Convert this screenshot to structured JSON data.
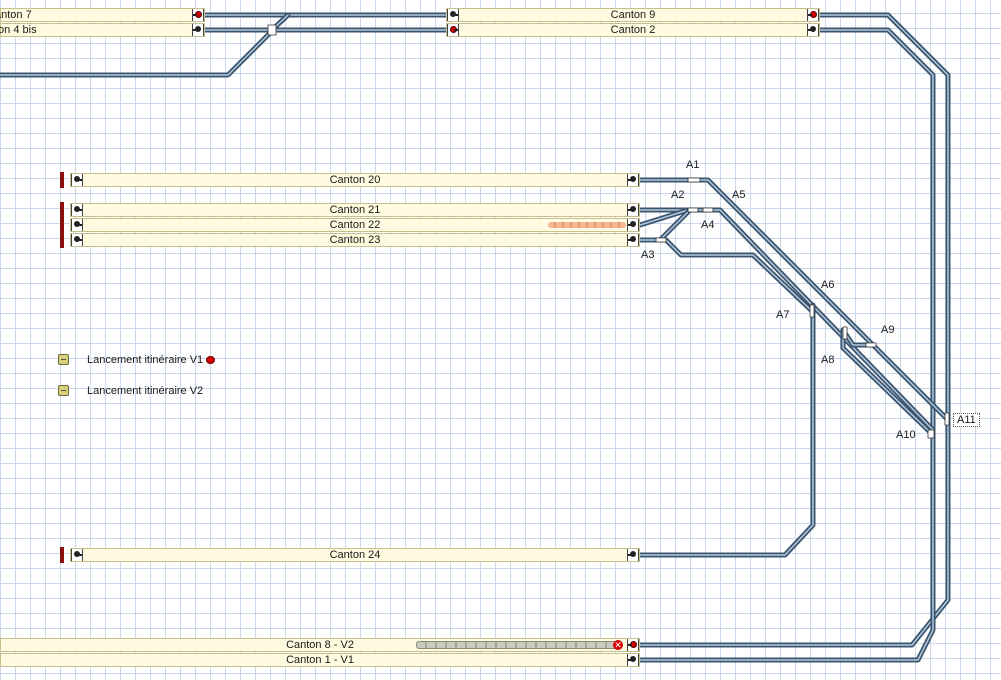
{
  "cantons": {
    "canton_7": "anton 7",
    "canton_4bis": "ton 4 bis",
    "canton_9": "Canton 9",
    "canton_2": "Canton 2",
    "canton_20": "Canton 20",
    "canton_21": "Canton 21",
    "canton_22": "Canton 22",
    "canton_23": "Canton 23",
    "canton_24": "Canton 24",
    "canton_8": "Canton 8 - V2",
    "canton_1": "Canton 1 - V1"
  },
  "switches": {
    "a1": "A1",
    "a2": "A2",
    "a3": "A3",
    "a4": "A4",
    "a5": "A5",
    "a6": "A6",
    "a7": "A7",
    "a8": "A8",
    "a9": "A9",
    "a10": "A10",
    "a11": "A11"
  },
  "routes": {
    "v1_label": "Lancement itinéraire V1",
    "v2_label": "Lancement itinéraire V2"
  },
  "colors": {
    "track_outer": "#3a5570",
    "track_inner": "#b6c8da",
    "canton_fill": "#fffbe0",
    "signal_red": "#d40000"
  },
  "icons": {
    "signal": "signal-dot-icon",
    "buffer": "buffer-stop-icon",
    "launch": "route-launch-icon",
    "close": "close-icon"
  }
}
